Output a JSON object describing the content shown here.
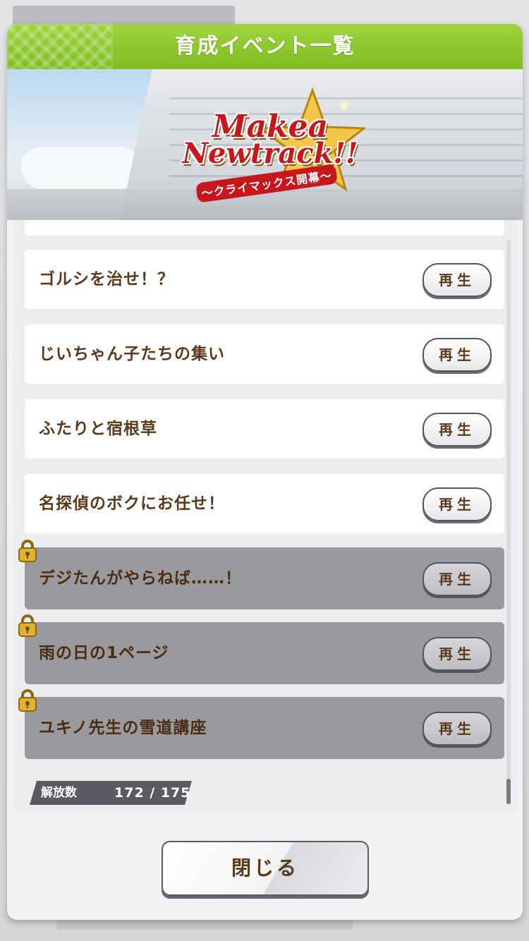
{
  "dialog": {
    "title": "育成イベント一覧",
    "close_label": "閉じる"
  },
  "banner": {
    "logo_line1": "Makea",
    "logo_line2": "Newtrack!!",
    "logo_subtitle": "〜クライマックス開幕〜"
  },
  "events": [
    {
      "label": "ゴルシを治せ！？",
      "button": "再生",
      "locked": false
    },
    {
      "label": "じいちゃん子たちの集い",
      "button": "再生",
      "locked": false
    },
    {
      "label": "ふたりと宿根草",
      "button": "再生",
      "locked": false
    },
    {
      "label": "名探偵のボクにお任せ！",
      "button": "再生",
      "locked": false
    },
    {
      "label": "デジたんがやらねば……！",
      "button": "再生",
      "locked": true
    },
    {
      "label": "雨の日の1ページ",
      "button": "再生",
      "locked": true
    },
    {
      "label": "ユキノ先生の雪道講座",
      "button": "再生",
      "locked": true
    }
  ],
  "unlock_count": {
    "label": "解放数",
    "value": "172 / 175"
  },
  "colors": {
    "title_green": "#8cc63f",
    "text_brown": "#5b3a1c",
    "locked_row": "#9a9a9e",
    "lock_gold": "#d9a826"
  }
}
